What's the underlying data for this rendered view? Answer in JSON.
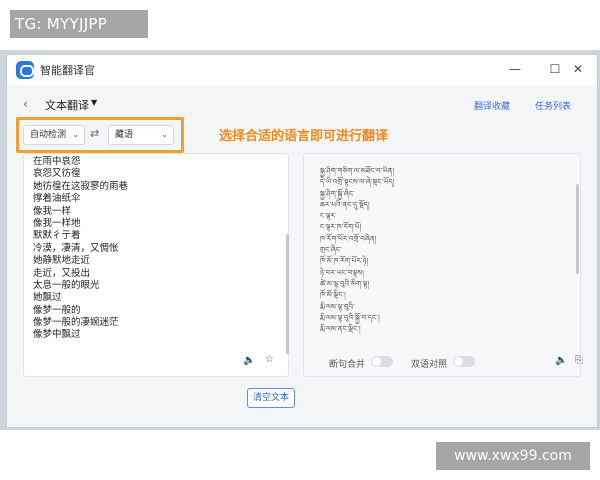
{
  "watermarks": {
    "top": "TG: MYYJJPP",
    "bottom": "www.xwx99.com"
  },
  "window": {
    "title": "智能翻译官",
    "controls": {
      "minimize": "—",
      "maximize": "☐",
      "close": "✕"
    }
  },
  "header": {
    "back": "‹",
    "mode_title": "文本翻译",
    "mode_caret": "▼",
    "links": {
      "favorites": "翻译收藏",
      "tasks": "任务列表"
    }
  },
  "language": {
    "source": "自动检测",
    "target": "藏语",
    "swap_icon": "⇄",
    "caret": "⌄"
  },
  "annotation": "选择合适的语言即可进行翻译",
  "source_text": [
    "在雨中哀怨",
    "哀怨又彷徨",
    "她彷徨在这寂寥的雨巷",
    "撑着油纸伞",
    "像我一样",
    "像我一样地",
    "默默彳亍着",
    "冷漠，凄清，又惆怅",
    "她静默地走近",
    "走近，又投出",
    "太息一般的眼光",
    "她飘过",
    "像梦一般的",
    "像梦一般的凄婉迷茫",
    "像梦中飘过"
  ],
  "translated_text": [
    "སྐྱ་ཤིག་གཅིག་ལ་མཐོང་བ་ཡིན།",
    "དེ་ཡི་འགྲོ་སྟངས་ལ་ཞེ་སྡང་ཡོད།",
    "སྐྱ་ཤིག་སྐྱོ་ཞིང་",
    "ཆར་པའི་ནང་དུ་སྡོད།",
    "ང་ལྟར་",
    "ང་ལྟར་ཁ་རོག་པོ།",
    "ཁ་རོག་པོར་འགྲོ་བཞིན།",
    "གྲང་ཞིང་",
    "ཁོ་མོ་ཁ་རོག་པོར་ཉེ།",
    "ཉེ་བར་ཡང་བལྟས།",
    "ཚེ་མ་ལྟ་བུའི་མིག་ལྟ།",
    "ཁོ་མོ་ལྡིང་།",
    "རྨི་ལམ་ལྟ་བུའི་",
    "རྨི་ལམ་ལྟ་བུའི་སྐྱོ་བ་དང་།",
    "རྨི་ལམ་ནང་ལྡིང་།"
  ],
  "source_actions": {
    "speaker_icon": "🔈",
    "star_icon": "☆"
  },
  "target_actions": {
    "merge_label": "断句合并",
    "bilingual_label": "双语对照",
    "speaker_icon": "🔈",
    "copy_icon": "⎘"
  },
  "clear_button": "清空文本",
  "colors": {
    "accent": "#2f63c9",
    "highlight": "#f0a030",
    "annotation": "#f08a1c"
  }
}
